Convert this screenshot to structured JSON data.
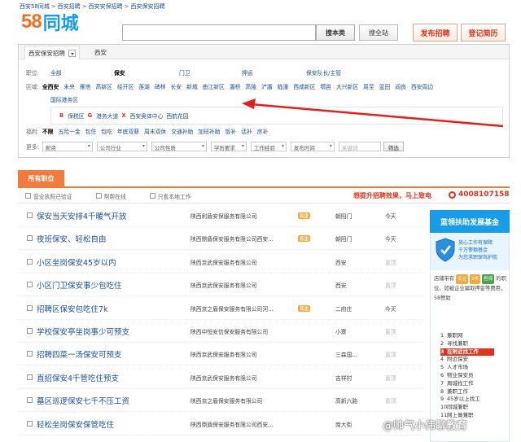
{
  "breadcrumb": [
    "西安58同城",
    "西安招聘",
    "西安安保招聘",
    "西安保安招聘"
  ],
  "logo": {
    "number": "58",
    "text": "同城"
  },
  "search": {
    "value": "",
    "btn_this": "搜本类",
    "btn_all": "搜全站"
  },
  "header_buttons": {
    "post": "发布招聘",
    "resume": "登记简历"
  },
  "tabs": {
    "category": "西安保安招聘",
    "city": "西安"
  },
  "filters": {
    "position": {
      "label": "职位:",
      "items": [
        "全部",
        "保安",
        "门卫",
        "押运",
        "保安队长/主管"
      ],
      "selected": "保安"
    },
    "area": {
      "label": "区域:",
      "items": [
        "全西安",
        "未央",
        "雁塔",
        "高新区",
        "经开区",
        "莲湖",
        "碑林",
        "长安",
        "新城",
        "曲江新区",
        "灞桥",
        "高陵",
        "浐灞",
        "临潼",
        "西咸新区",
        "鄠邑",
        "大兴新区",
        "周至",
        "蓝田",
        "阎良",
        "西安周边"
      ],
      "items2": [
        "国际港务区"
      ],
      "selected": "全西安"
    },
    "biz_areas": [
      {
        "letter": "B",
        "name": "保税区"
      },
      {
        "letter": "G",
        "name": "港务大道"
      },
      {
        "letter": "X",
        "name": "西安奥体中心"
      },
      {
        "letter": "",
        "name": "西航花园"
      }
    ],
    "benefits": {
      "label": "福利:",
      "items": [
        "不限",
        "五险一金",
        "包住",
        "包吃",
        "年底双薪",
        "周末双休",
        "交通补助",
        "加班补助",
        "饭补",
        "话补",
        "房补"
      ],
      "selected": "不限"
    },
    "more": {
      "label": "更多:",
      "selects": [
        "薪资",
        "公司行业",
        "公司性质",
        "学历要求",
        "工作经验",
        "发布时间"
      ],
      "keyword_placeholder": "关键词",
      "filter_btn": "筛选"
    }
  },
  "jobs_tab": "所有职位",
  "options": [
    "营业执照已验证",
    "帮帮在线",
    "只看本地工作"
  ],
  "promo": "想提升招聘效果，马上致电",
  "phone": "4008107158",
  "jobs": [
    {
      "title": "保安当天安排4千暖气开放",
      "company": "陕西利盾安保服务有限公司",
      "badge": "名企",
      "location": "朝阳门",
      "date": "今天",
      "old": false
    },
    {
      "title": "夜班保安、轻松自由",
      "company": "陕西鼎盾保安服务有限公司西安...",
      "badge": "名企",
      "location": "朝阳门",
      "date": "今天",
      "old": false
    },
    {
      "title": "小区坐岗保安45岁以内",
      "company": "陕西京武保安服务有限公司",
      "badge": "",
      "location": "西安",
      "date": "置顶",
      "old": true
    },
    {
      "title": "小区门卫保安事少包吃住",
      "company": "陕西京武保安服务有限公司",
      "badge": "",
      "location": "西安",
      "date": "置顶",
      "old": true
    },
    {
      "title": "招聘区保安包吃住7k",
      "company": "陕西京之盾保安服务有限公司河...",
      "badge": "名企",
      "location": "二府庄",
      "date": "今天",
      "old": false
    },
    {
      "title": "学校保安亭坐岗事少可预支",
      "company": "陕西中恒安信保安服务有限公司",
      "badge": "",
      "location": "小寨",
      "date": "置顶",
      "old": true
    },
    {
      "title": "招聘四菜一汤保安可预支",
      "company": "陕西京武保安服务有限公司",
      "badge": "",
      "location": "三森国...",
      "date": "置顶",
      "old": true
    },
    {
      "title": "直招保安4千管吃住预支",
      "company": "陕西京武保安服务有限公司",
      "badge": "",
      "location": "吉祥村",
      "date": "置顶",
      "old": true
    },
    {
      "title": "墓区巡逻保安七千不压工资",
      "company": "陕西京之盾保安服务有限公司",
      "badge": "",
      "location": "高新六路",
      "date": "置顶",
      "old": true
    },
    {
      "title": "轻松坐岗保安保管吃住",
      "company": "陕西鼎盾保安服务有限公司西安...",
      "badge": "",
      "location": "南大街",
      "date": "置顶",
      "old": true
    }
  ],
  "side": {
    "title": "蓝领扶助发展基金",
    "banner": [
      "放心工作有保障",
      "千万警额基金",
      "为您求职保驾护航"
    ],
    "desc_pre": "店铺带有",
    "pill1": "名企",
    "pill1b": "1年",
    "pill2": "担保",
    "desc_post": "的职位，如被企业骗取押金等费用，58赞助",
    "hot": [
      {
        "n": "1",
        "t": "兼职网",
        "active": false
      },
      {
        "n": "2",
        "t": "寻找兼职",
        "active": false
      },
      {
        "n": "3",
        "t": "在附近找工作",
        "active": true
      },
      {
        "n": "4",
        "t": "附近保安",
        "active": false
      },
      {
        "n": "5",
        "t": "人才市场",
        "active": false
      },
      {
        "n": "6",
        "t": "物业保安员",
        "active": false
      },
      {
        "n": "7",
        "t": "周城找工作",
        "active": false
      },
      {
        "n": "8",
        "t": "兼职工作",
        "active": false
      },
      {
        "n": "9",
        "t": "45岁以上找工",
        "active": false
      },
      {
        "n": "10",
        "t": "同城兼职",
        "active": false
      },
      {
        "n": "11",
        "t": "网上做兼职",
        "active": false
      }
    ]
  },
  "watermark": "@帅气小伟聊教育",
  "colors": {
    "brand_orange": "#f37a3b",
    "link_blue": "#1a4f9c",
    "accent_red": "#e0331a",
    "side_blue": "#1a9be8"
  }
}
